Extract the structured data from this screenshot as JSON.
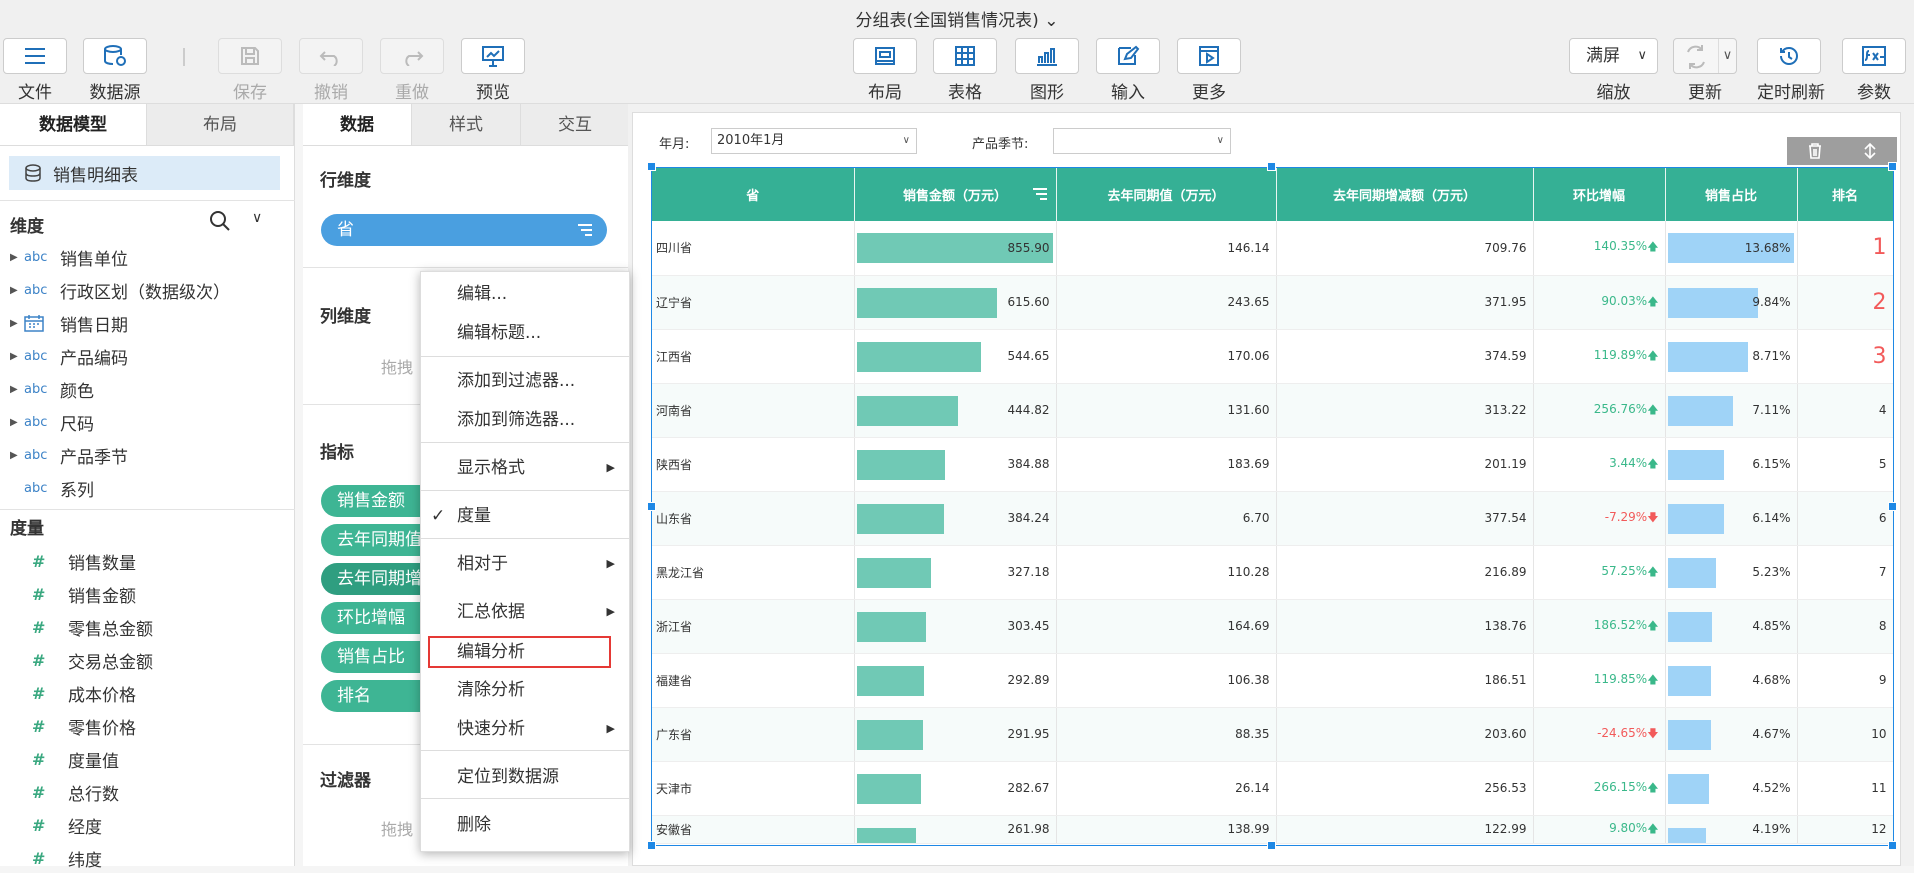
{
  "title": "分组表(全国销售情况表)",
  "toolbar": {
    "file": "文件",
    "datasource": "数据源",
    "save": "保存",
    "undo": "撤销",
    "redo": "重做",
    "preview": "预览",
    "layout": "布局",
    "table": "表格",
    "graph": "图形",
    "input": "输入",
    "more": "更多",
    "zoom_value": "满屏",
    "zoom": "缩放",
    "refresh": "更新",
    "timed_refresh": "定时刷新",
    "params": "参数"
  },
  "left": {
    "tabs": [
      "数据模型",
      "布局"
    ],
    "source": "销售明细表",
    "dim_header": "维度",
    "dimensions": [
      {
        "type": "abc",
        "label": "销售单位"
      },
      {
        "type": "abc",
        "label": "行政区划（数据级次）"
      },
      {
        "type": "date",
        "label": "销售日期"
      },
      {
        "type": "abc",
        "label": "产品编码"
      },
      {
        "type": "abc",
        "label": "颜色"
      },
      {
        "type": "abc",
        "label": "尺码"
      },
      {
        "type": "abc",
        "label": "产品季节"
      },
      {
        "type": "abc",
        "label": "系列"
      }
    ],
    "measure_header": "度量",
    "measures": [
      "销售数量",
      "销售金额",
      "零售总金额",
      "交易总金额",
      "成本价格",
      "零售价格",
      "度量值",
      "总行数",
      "经度",
      "纬度"
    ]
  },
  "mid": {
    "tabs": [
      "数据",
      "样式",
      "交互"
    ],
    "row_dim": "行维度",
    "row_pill": "省",
    "col_dim": "列维度",
    "drop_hint": "拖拽",
    "indicators": "指标",
    "indicator_pills": [
      "销售金额",
      "去年同期值",
      "去年同期增",
      "环比增幅",
      "销售占比",
      "排名"
    ],
    "filter": "过滤器",
    "drop_hint2": "拖拽"
  },
  "context_menu": {
    "items": [
      "编辑...",
      "编辑标题...",
      "添加到过滤器...",
      "添加到筛选器...",
      "显示格式",
      "度量",
      "相对于",
      "汇总依据",
      "编辑分析",
      "清除分析",
      "快速分析",
      "定位到数据源",
      "删除"
    ]
  },
  "filters": {
    "month_label": "年月:",
    "month_value": "2010年1月",
    "season_label": "产品季节:",
    "season_value": ""
  },
  "table": {
    "headers": [
      "省",
      "销售金额（万元）",
      "去年同期值（万元）",
      "去年同期增减额（万元）",
      "环比增幅",
      "销售占比",
      "排名"
    ],
    "rows": [
      {
        "prov": "四川省",
        "sales": "855.90",
        "sales_v": 855.9,
        "ly": "146.14",
        "diff": "709.76",
        "mom": "140.35%",
        "dir": "up",
        "share": "13.68%",
        "share_v": 13.68,
        "rank": "1"
      },
      {
        "prov": "辽宁省",
        "sales": "615.60",
        "sales_v": 615.6,
        "ly": "243.65",
        "diff": "371.95",
        "mom": "90.03%",
        "dir": "up",
        "share": "9.84%",
        "share_v": 9.84,
        "rank": "2"
      },
      {
        "prov": "江西省",
        "sales": "544.65",
        "sales_v": 544.65,
        "ly": "170.06",
        "diff": "374.59",
        "mom": "119.89%",
        "dir": "up",
        "share": "8.71%",
        "share_v": 8.71,
        "rank": "3"
      },
      {
        "prov": "河南省",
        "sales": "444.82",
        "sales_v": 444.82,
        "ly": "131.60",
        "diff": "313.22",
        "mom": "256.76%",
        "dir": "up",
        "share": "7.11%",
        "share_v": 7.11,
        "rank": "4"
      },
      {
        "prov": "陕西省",
        "sales": "384.88",
        "sales_v": 384.88,
        "ly": "183.69",
        "diff": "201.19",
        "mom": "3.44%",
        "dir": "up",
        "share": "6.15%",
        "share_v": 6.15,
        "rank": "5"
      },
      {
        "prov": "山东省",
        "sales": "384.24",
        "sales_v": 384.24,
        "ly": "6.70",
        "diff": "377.54",
        "mom": "-7.29%",
        "dir": "down",
        "share": "6.14%",
        "share_v": 6.14,
        "rank": "6"
      },
      {
        "prov": "黑龙江省",
        "sales": "327.18",
        "sales_v": 327.18,
        "ly": "110.28",
        "diff": "216.89",
        "mom": "57.25%",
        "dir": "up",
        "share": "5.23%",
        "share_v": 5.23,
        "rank": "7"
      },
      {
        "prov": "浙江省",
        "sales": "303.45",
        "sales_v": 303.45,
        "ly": "164.69",
        "diff": "138.76",
        "mom": "186.52%",
        "dir": "up",
        "share": "4.85%",
        "share_v": 4.85,
        "rank": "8"
      },
      {
        "prov": "福建省",
        "sales": "292.89",
        "sales_v": 292.89,
        "ly": "106.38",
        "diff": "186.51",
        "mom": "119.85%",
        "dir": "up",
        "share": "4.68%",
        "share_v": 4.68,
        "rank": "9"
      },
      {
        "prov": "广东省",
        "sales": "291.95",
        "sales_v": 291.95,
        "ly": "88.35",
        "diff": "203.60",
        "mom": "-24.65%",
        "dir": "down",
        "share": "4.67%",
        "share_v": 4.67,
        "rank": "10"
      },
      {
        "prov": "天津市",
        "sales": "282.67",
        "sales_v": 282.67,
        "ly": "26.14",
        "diff": "256.53",
        "mom": "266.15%",
        "dir": "up",
        "share": "4.52%",
        "share_v": 4.52,
        "rank": "11"
      },
      {
        "prov": "安徽省",
        "sales": "261.98",
        "sales_v": 261.98,
        "ly": "138.99",
        "diff": "122.99",
        "mom": "9.80%",
        "dir": "up",
        "share": "4.19%",
        "share_v": 4.19,
        "rank": "12"
      }
    ]
  },
  "colors": {
    "header": "#35b095",
    "bar": "#70c9b5",
    "share_bar": "#9fd3f7",
    "up": "#3ab88a",
    "down": "#f25a5a",
    "accent": "#1e88e5"
  }
}
